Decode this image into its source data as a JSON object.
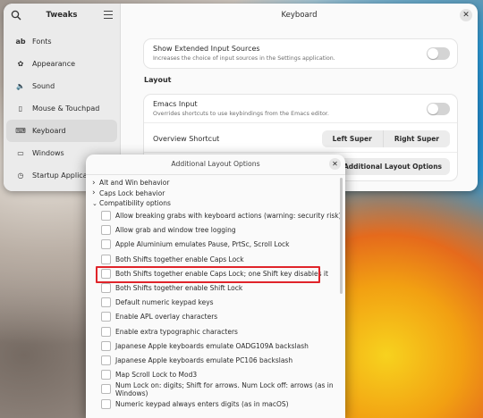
{
  "window": {
    "app_title": "Tweaks",
    "page_title": "Keyboard",
    "close_glyph": "✕",
    "sidebar": [
      {
        "label": "Fonts",
        "icon": "fonts-icon",
        "glyph": "ab",
        "active": false
      },
      {
        "label": "Appearance",
        "icon": "appearance-icon",
        "glyph": "✿",
        "active": false
      },
      {
        "label": "Sound",
        "icon": "sound-icon",
        "glyph": "🔈",
        "active": false
      },
      {
        "label": "Mouse & Touchpad",
        "icon": "mouse-icon",
        "glyph": "▯",
        "active": false
      },
      {
        "label": "Keyboard",
        "icon": "keyboard-icon",
        "glyph": "⌨",
        "active": true
      },
      {
        "label": "Windows",
        "icon": "windows-icon",
        "glyph": "▭",
        "active": false
      },
      {
        "label": "Startup Applications",
        "icon": "startup-icon",
        "glyph": "◷",
        "active": false
      }
    ]
  },
  "main": {
    "extended_input": {
      "title": "Show Extended Input Sources",
      "subtitle": "Increases the choice of input sources in the Settings application.",
      "enabled": false
    },
    "layout_label": "Layout",
    "emacs": {
      "title": "Emacs Input",
      "subtitle": "Overrides shortcuts to use keybindings from the Emacs editor.",
      "enabled": false
    },
    "overview_shortcut": {
      "label": "Overview Shortcut",
      "options": [
        "Left Super",
        "Right Super"
      ]
    },
    "additional_layout_button": "Additional Layout Options"
  },
  "dialog": {
    "title": "Additional Layout Options",
    "close_glyph": "✕",
    "groups": [
      {
        "label": "Alt and Win behavior",
        "expanded": false
      },
      {
        "label": "Caps Lock behavior",
        "expanded": false
      },
      {
        "label": "Compatibility options",
        "expanded": true
      }
    ],
    "options": [
      {
        "label": "Allow breaking grabs with keyboard actions (warning: security risk)",
        "checked": false
      },
      {
        "label": "Allow grab and window tree logging",
        "checked": false
      },
      {
        "label": "Apple Aluminium emulates Pause, PrtSc, Scroll Lock",
        "checked": false
      },
      {
        "label": "Both Shifts together enable Caps Lock",
        "checked": false
      },
      {
        "label": "Both Shifts together enable Caps Lock; one Shift key disables it",
        "checked": false,
        "highlighted": true
      },
      {
        "label": "Both Shifts together enable Shift Lock",
        "checked": false
      },
      {
        "label": "Default numeric keypad keys",
        "checked": false
      },
      {
        "label": "Enable APL overlay characters",
        "checked": false
      },
      {
        "label": "Enable extra typographic characters",
        "checked": false
      },
      {
        "label": "Japanese Apple keyboards emulate OADG109A backslash",
        "checked": false
      },
      {
        "label": "Japanese Apple keyboards emulate PC106 backslash",
        "checked": false
      },
      {
        "label": "Map Scroll Lock to Mod3",
        "checked": false
      },
      {
        "label": "Num Lock on: digits; Shift for arrows. Num Lock off: arrows (as in Windows)",
        "checked": false
      },
      {
        "label": "Numeric keypad always enters digits (as in macOS)",
        "checked": false
      }
    ]
  },
  "colors": {
    "highlight": "#e0242a",
    "window_bg": "#fafafa",
    "sidebar_bg": "#ebebeb"
  }
}
